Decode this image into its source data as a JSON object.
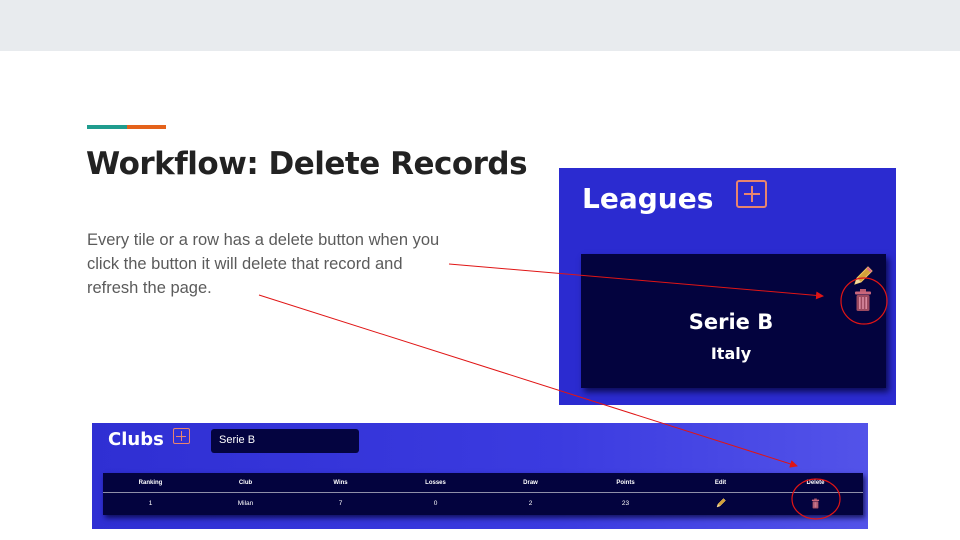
{
  "slide": {
    "title": "Workflow: Delete Records",
    "body": "Every tile or a row has a delete button when you click the button it will delete that record and refresh the page."
  },
  "leagues": {
    "title": "Leagues",
    "card": {
      "name": "Serie B",
      "country": "Italy"
    }
  },
  "clubs": {
    "title": "Clubs",
    "league_select_value": "Serie B",
    "columns": [
      "Ranking",
      "Club",
      "Wins",
      "Losses",
      "Draw",
      "Points",
      "Edit",
      "Delete"
    ],
    "rows": [
      {
        "ranking": "1",
        "club": "Milan",
        "wins": "7",
        "losses": "0",
        "draw": "2",
        "points": "23"
      }
    ]
  },
  "colors": {
    "accent_teal": "#1f9c8e",
    "accent_orange": "#e4621b",
    "app_blue": "#2b2bd0",
    "card_navy": "#03033e",
    "annotation_red": "#e01515",
    "add_icon": "#e8856e"
  },
  "icons": {
    "add": "plus-square-icon",
    "edit": "pencil-icon",
    "delete": "trash-icon"
  }
}
